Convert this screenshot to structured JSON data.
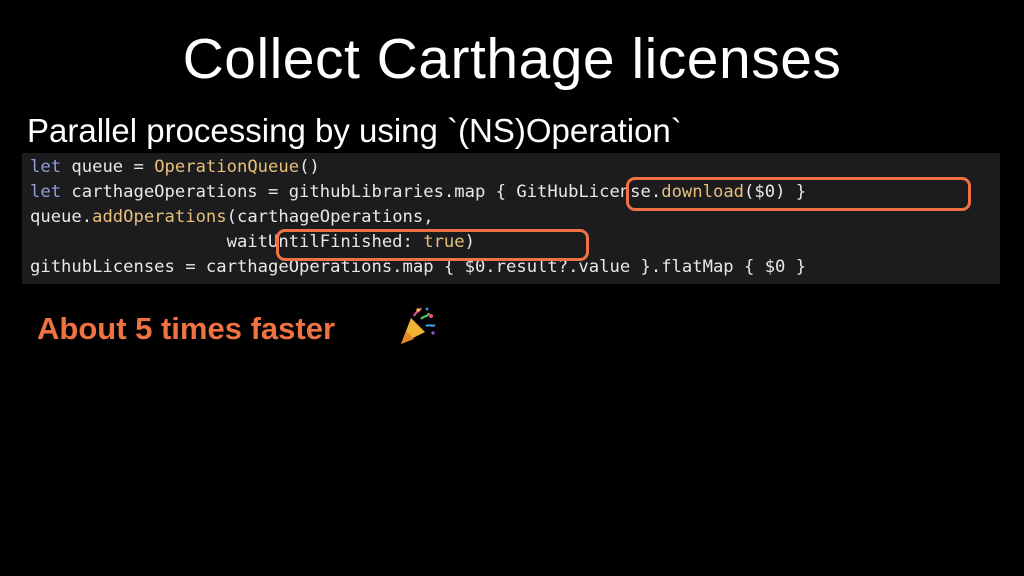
{
  "slide": {
    "title": "Collect Carthage licenses",
    "subtitle": "Parallel processing by using `(NS)Operation`",
    "callout": "About 5 times faster",
    "callout_icon": "party-popper-icon",
    "accent_color": "#ee7244"
  },
  "code": {
    "line1": {
      "kw": "let",
      "rest": " queue = ",
      "fn": "OperationQueue",
      "tail": "()"
    },
    "line2": {
      "kw": "let",
      "rest": " carthageOperations = githubLibraries.map { ",
      "hl_a": "GitHubLicense.",
      "hl_fn": "download",
      "hl_b": "($0)",
      "tail": " }"
    },
    "line3": {
      "lead": "queue.",
      "fn": "addOperations",
      "rest": "(carthageOperations,"
    },
    "line4": {
      "indent": "                   ",
      "label": "waitUntilFinished: ",
      "val": "true",
      "tail": ")"
    },
    "line5": "githubLicenses = carthageOperations.map { $0.result?.value }.flatMap { $0 }"
  }
}
